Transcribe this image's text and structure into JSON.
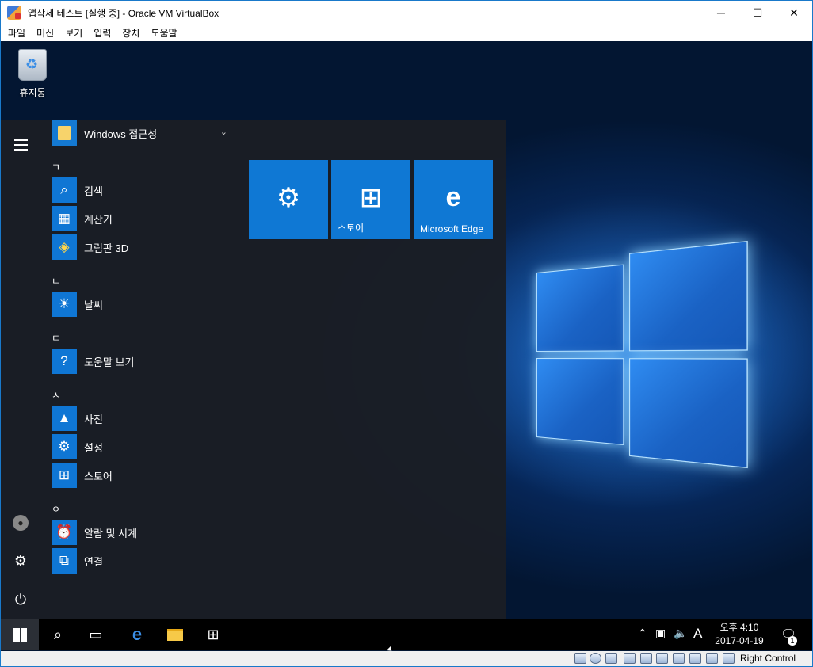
{
  "window": {
    "title": "앱삭제 테스트 [실행 중] - Oracle VM VirtualBox",
    "minimize_glyph": "─",
    "maximize_glyph": "☐",
    "close_glyph": "✕"
  },
  "menubar": [
    "파일",
    "머신",
    "보기",
    "입력",
    "장치",
    "도움말"
  ],
  "desktop": {
    "recycle_bin_label": "휴지통"
  },
  "start_menu": {
    "folder": {
      "label": "Windows 접근성",
      "chevron": "⌄"
    },
    "sections": [
      {
        "header": "ㄱ",
        "apps": [
          "검색",
          "계산기",
          "그림판 3D"
        ]
      },
      {
        "header": "ㄴ",
        "apps": [
          "날씨"
        ]
      },
      {
        "header": "ㄷ",
        "apps": [
          "도움말 보기"
        ]
      },
      {
        "header": "ㅅ",
        "apps": [
          "사진",
          "설정",
          "스토어"
        ]
      },
      {
        "header": "ㅇ",
        "apps": [
          "알람 및 시계",
          "연결"
        ]
      }
    ],
    "tiles": [
      {
        "label": "",
        "icon": "gear-icon"
      },
      {
        "label": "스토어",
        "icon": "store-icon"
      },
      {
        "label": "Microsoft Edge",
        "icon": "edge-icon"
      }
    ]
  },
  "taskbar": {
    "clock_time": "오후 4:10",
    "clock_date": "2017-04-19",
    "ime_label": "A",
    "notification_count": "1"
  },
  "statusbar": {
    "host_key": "Right Control"
  },
  "colors": {
    "accent": "#0f78d4",
    "titlebar_border": "#1979ca",
    "start_bg": "#1a1e25"
  }
}
